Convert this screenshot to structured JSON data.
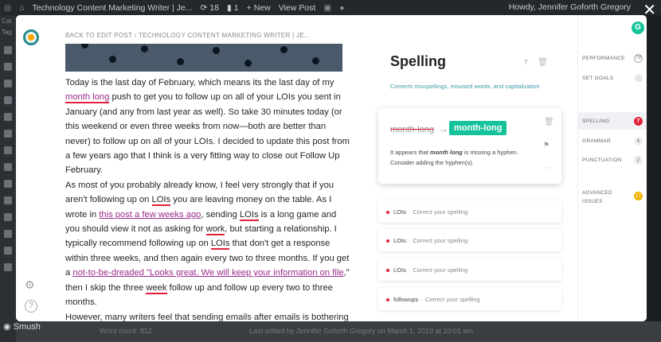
{
  "wpbar": {
    "site_title": "Technology Content Marketing Writer | Je...",
    "updates_count": "18",
    "comments_count": "1",
    "new_label": "New",
    "view_post_label": "View Post",
    "howdy": "Howdy, Jennifer Goforth Gregory"
  },
  "wpside": {
    "partial_labels": [
      "Cat",
      "Tag"
    ]
  },
  "bottom": {
    "word_count": "Word count: 812",
    "last_edited": "Last edited by Jennifer Goforth Gregory on March 1, 2019 at 10:01 am",
    "smush": "Smush"
  },
  "editor": {
    "back_link": "BACK TO EDIT POST › TECHNOLOGY CONTENT MARKETING WRITER | JE...",
    "p1_a": "Today is the last day of February, which means its the last day of my ",
    "p1_err": "month long",
    "p1_b": " push to get you to follow up on all of your LOIs you sent in January (and any from last year as well). So take 30 minutes today (or this weekend or even three weeks from now—both are better than never) to follow up on all of your LOIs. I decided to update this post from a few years ago that I think is a very fitting way to close out Follow Up February.",
    "p2_a": "As most of you probably already know, I feel very strongly that if you aren't following up on ",
    "p2_lois1": "LOIs",
    "p2_b": " you are leaving money on the table. As I wrote in ",
    "p2_link": "this post a few weeks ago",
    "p2_c": ", sending ",
    "p2_lois2": "LOIs",
    "p2_d": " is a long game and you should view it not as asking for ",
    "p2_work": "work",
    "p2_e": ", but starting a relationship. I typically recommend following up on ",
    "p2_lois3": "LOIs",
    "p2_f": " that don't get a response within three weeks, and then again every two to three months. If you get a ",
    "p2_link2": "not-to-be-dreaded \"Looks great. We will keep your information on file",
    "p2_g": ",\" then I skip the three ",
    "p2_week": "week",
    "p2_h": " follow up and follow up every two to three months.",
    "p3": "However, many writers feel that sending emails after emails is bothering the editor. And that's a fair point. Following up doesn't have to be just an"
  },
  "panel": {
    "title": "Spelling",
    "count": "7",
    "subtitle": "Corrects misspellings, misused words, and capitalization",
    "card": {
      "wrong": "month-long",
      "fix": "month-long",
      "explain_a": "It appears that ",
      "explain_term": "month long",
      "explain_b": " is missing a hyphen. Consider adding the hyphen(s)."
    },
    "items": [
      {
        "word": "LOIs",
        "action": "Correct your spelling"
      },
      {
        "word": "LOIs",
        "action": "Correct your spelling"
      },
      {
        "word": "LOIs",
        "action": "Correct your spelling"
      },
      {
        "word": "followups",
        "action": "Correct your spelling"
      }
    ]
  },
  "sidebar": {
    "performance": "PERFORMANCE",
    "performance_score": "79",
    "set_goals": "SET GOALS",
    "spelling": "SPELLING",
    "spelling_count": "7",
    "grammar": "GRAMMAR",
    "grammar_count": "4",
    "punctuation": "PUNCTUATION",
    "punctuation_count": "2",
    "advanced": "ADVANCED",
    "issues": "ISSUES",
    "advanced_count": "17",
    "grammarly_logo": "G"
  },
  "colors": {
    "accent": "#15c39a",
    "error": "#e2203d",
    "subtitle": "#3b9aa8"
  }
}
